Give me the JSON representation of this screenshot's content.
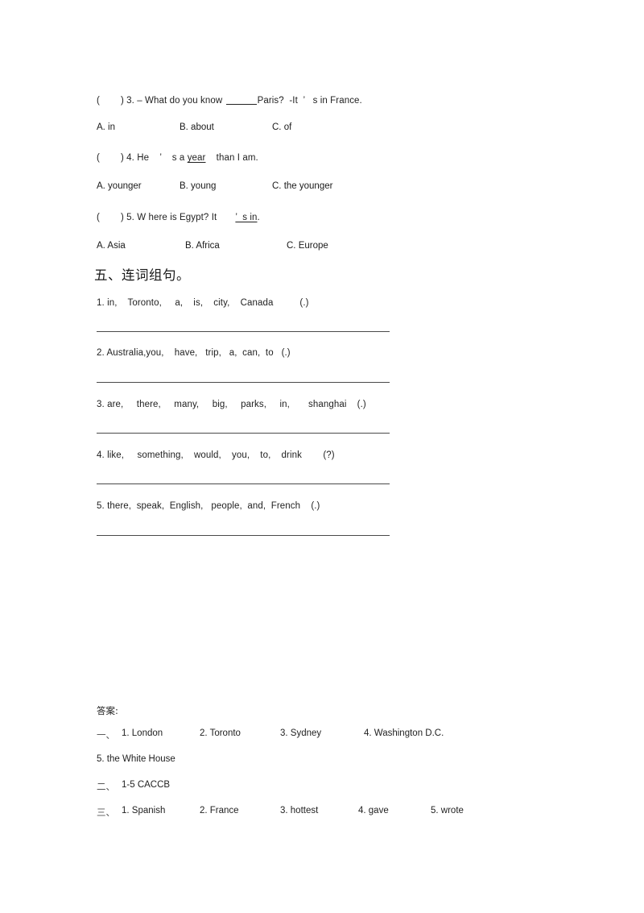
{
  "document": {
    "background_color": "#ffffff",
    "text_color": "#1f1f1f",
    "rule_color": "#4a4a4a"
  },
  "choice_questions": [
    {
      "bracket_open": "(",
      "bracket_close": ")",
      "number": "3.",
      "stem_before_blank": "– What do you know ",
      "stem_after_blank": "Paris?  -It  ’   s in France.",
      "options": [
        {
          "label": "A. in"
        },
        {
          "label": "B. about"
        },
        {
          "label": "C. of"
        }
      ]
    },
    {
      "bracket_open": "(",
      "bracket_close": ")",
      "number": "4.",
      "stem_plain_a": "He    ’    s a ",
      "stem_underlined": "year",
      "stem_plain_b": "    than I am.",
      "options": [
        {
          "label": "A. younger"
        },
        {
          "label": "B. young"
        },
        {
          "label": "C. the younger"
        }
      ]
    },
    {
      "bracket_open": "(",
      "bracket_close": ")",
      "number": "5.",
      "stem_plain_a": "W here is Egypt? It       ",
      "stem_underlined": "’  s in",
      "stem_plain_b": ".",
      "options": [
        {
          "label": "A. Asia"
        },
        {
          "label": "B. Africa"
        },
        {
          "label": "C. Europe"
        }
      ]
    }
  ],
  "section_five": {
    "heading": "五、连词组句。",
    "items": [
      {
        "number": "1.",
        "words": "in,    Toronto,     a,    is,    city,    Canada          (.)"
      },
      {
        "number": "2.",
        "words": "Australia,you,    have,   trip,   a,  can,  to   (.)"
      },
      {
        "number": "3.",
        "words": "are,     there,     many,     big,     parks,     in,       shanghai    (.)"
      },
      {
        "number": "4.",
        "words": "like,     something,    would,    you,    to,    drink        (?)"
      },
      {
        "number": "5.",
        "words": "there,  speak,  English,   people,  and,  French    (.)"
      }
    ]
  },
  "answer_key": {
    "heading": "答案:",
    "rows": [
      {
        "marker": "一、",
        "cells": [
          "1. London",
          "2. Toronto",
          "3. Sydney",
          "4. Washington D.C."
        ]
      },
      {
        "marker": "",
        "cells": [
          "5. the White House"
        ]
      },
      {
        "marker": "二、",
        "cells": [
          "1-5 CACCB"
        ]
      },
      {
        "marker": "三、",
        "cells": [
          "1. Spanish",
          "2. France",
          "3. hottest",
          "4. gave",
          "5. wrote"
        ]
      }
    ]
  }
}
